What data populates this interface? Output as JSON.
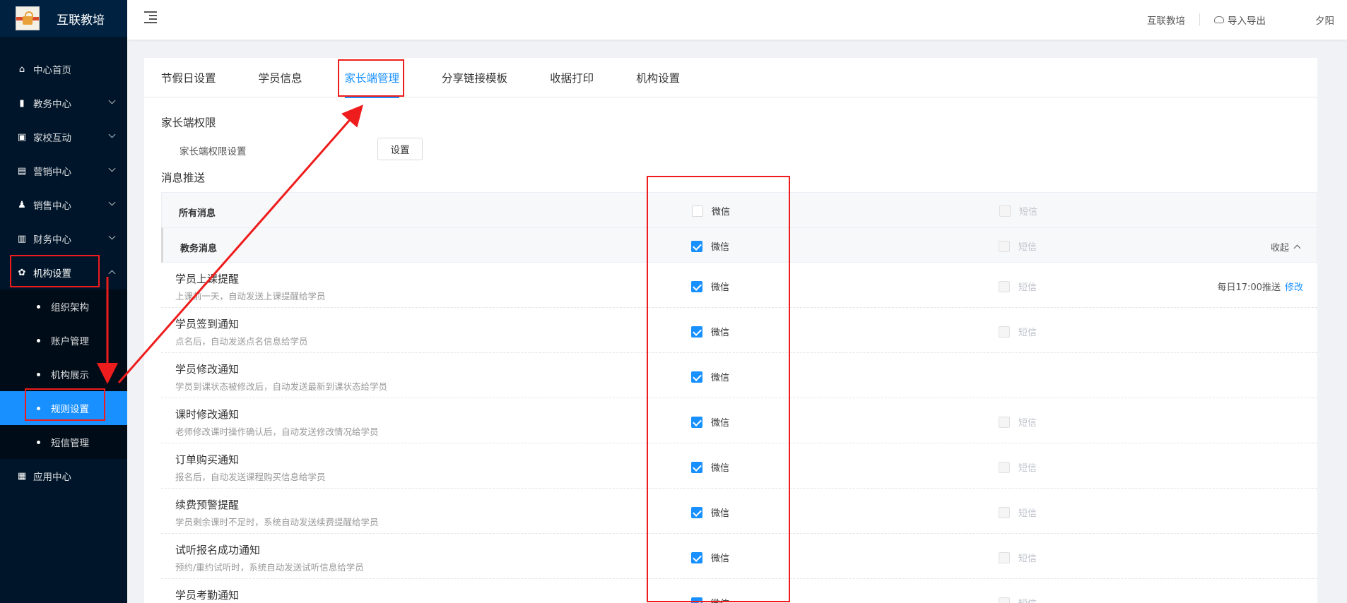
{
  "app": {
    "title": "互联教培"
  },
  "header": {
    "link_left": "互联教培",
    "export": "导入导出",
    "user": "夕阳"
  },
  "sidebar": {
    "items": [
      {
        "label": "中心首页",
        "icon": "home-icon"
      },
      {
        "label": "教务中心",
        "icon": "book-icon"
      },
      {
        "label": "家校互动",
        "icon": "chat-icon"
      },
      {
        "label": "营销中心",
        "icon": "bag-icon"
      },
      {
        "label": "销售中心",
        "icon": "users-icon"
      },
      {
        "label": "财务中心",
        "icon": "wallet-icon"
      },
      {
        "label": "机构设置",
        "icon": "gear-icon"
      }
    ],
    "sub_items": [
      {
        "label": "组织架构"
      },
      {
        "label": "账户管理"
      },
      {
        "label": "机构展示"
      },
      {
        "label": "规则设置"
      },
      {
        "label": "短信管理"
      }
    ],
    "app_center": {
      "label": "应用中心",
      "icon": "grid-icon"
    }
  },
  "tabs": [
    {
      "label": "节假日设置"
    },
    {
      "label": "学员信息"
    },
    {
      "label": "家长端管理"
    },
    {
      "label": "分享链接模板"
    },
    {
      "label": "收据打印"
    },
    {
      "label": "机构设置"
    }
  ],
  "parent_perm": {
    "section_title": "家长端权限",
    "label": "家长端权限设置",
    "button": "设置"
  },
  "push": {
    "section_title": "消息推送",
    "all_row": {
      "label": "所有消息",
      "wx": "微信",
      "sms": "短信"
    },
    "group_row": {
      "label": "教务消息",
      "wx": "微信",
      "sms": "短信",
      "collapse": "收起"
    },
    "wx_label": "微信",
    "sms_label": "短信",
    "rows": [
      {
        "name": "学员上课提醒",
        "desc": "上课前一天，自动发送上课提醒给学员",
        "wx": true,
        "sms": true,
        "schedule": "每日17:00推送",
        "edit": "修改"
      },
      {
        "name": "学员签到通知",
        "desc": "点名后，自动发送点名信息给学员",
        "wx": true,
        "sms": true
      },
      {
        "name": "学员修改通知",
        "desc": "学员到课状态被修改后，自动发送最新到课状态给学员",
        "wx": true,
        "sms": false
      },
      {
        "name": "课时修改通知",
        "desc": "老师修改课时操作确认后，自动发送修改情况给学员",
        "wx": true,
        "sms": true
      },
      {
        "name": "订单购买通知",
        "desc": "报名后，自动发送课程购买信息给学员",
        "wx": true,
        "sms": true
      },
      {
        "name": "续费预警提醒",
        "desc": "学员剩余课时不足时，系统自动发送续费提醒给学员",
        "wx": true,
        "sms": true
      },
      {
        "name": "试听报名成功通知",
        "desc": "预约/重约试听时，系统自动发送试听信息给学员",
        "wx": true,
        "sms": true
      },
      {
        "name": "学员考勤通知",
        "desc": "",
        "wx": true,
        "sms": true
      }
    ]
  },
  "colors": {
    "sidebar_bg": "#001529",
    "accent": "#1890ff",
    "annotation": "#ee1c1c"
  }
}
